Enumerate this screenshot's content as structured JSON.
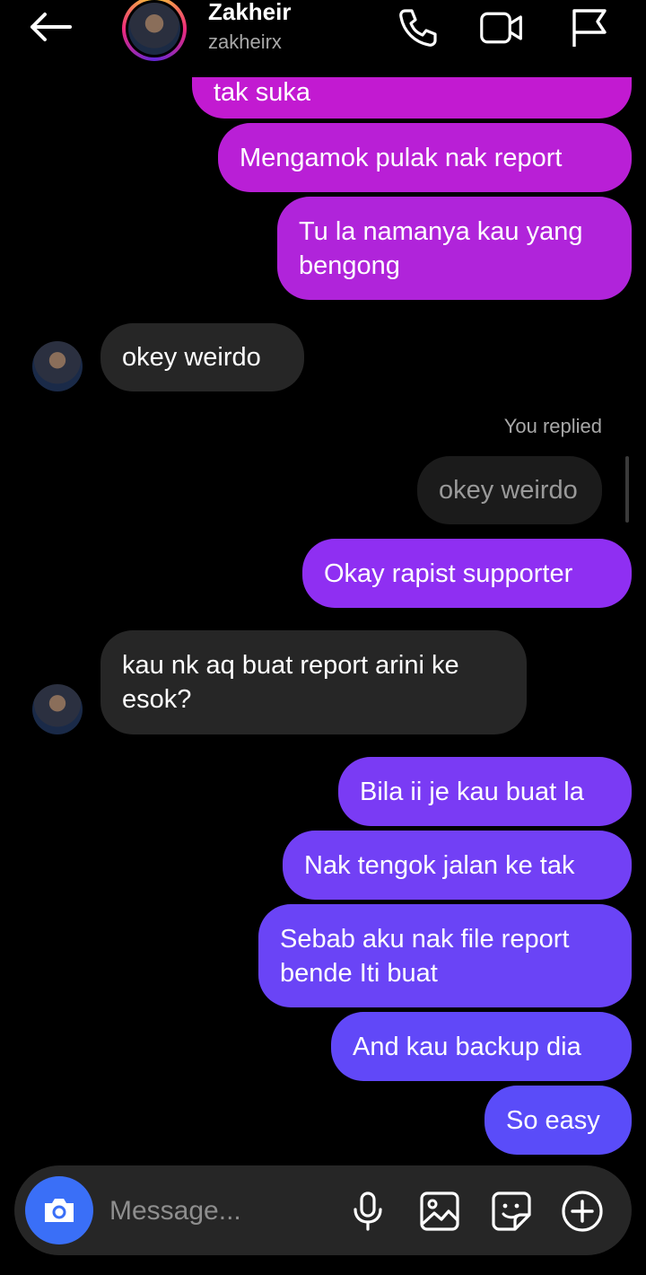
{
  "header": {
    "name": "Zakheir",
    "username": "zakheirx",
    "icons": [
      "back-arrow-icon",
      "phone-icon",
      "video-call-icon",
      "report-flag-icon"
    ]
  },
  "messages": {
    "m1": "tak suka",
    "m2": "Mengamok pulak nak report",
    "m3_l1": "Tu la namanya kau yang",
    "m3_l2": "bengong",
    "m4": "okey weirdo",
    "replied_label": "You replied",
    "m5_quote": "okey weirdo",
    "m6": "Okay rapist supporter",
    "m7_l1": "kau nk aq buat report arini ke",
    "m7_l2": "esok?",
    "m8": "Bila ii je kau buat la",
    "m9": "Nak tengok jalan ke tak",
    "m10_l1": "Sebab aku nak file report",
    "m10_l2": "bende Iti buat",
    "m11": "And kau backup dia",
    "m12": "So easy"
  },
  "composer": {
    "placeholder": "Message...",
    "icons": [
      "camera-icon",
      "microphone-icon",
      "gallery-icon",
      "sticker-icon",
      "add-icon"
    ]
  },
  "colors": {
    "bubble_top": "#c21ad1",
    "bubble_mid": "#8f2ff2",
    "bubble_bottom": "#5a4cf9",
    "incoming": "#262626",
    "camera_button": "#3a6ff7"
  }
}
